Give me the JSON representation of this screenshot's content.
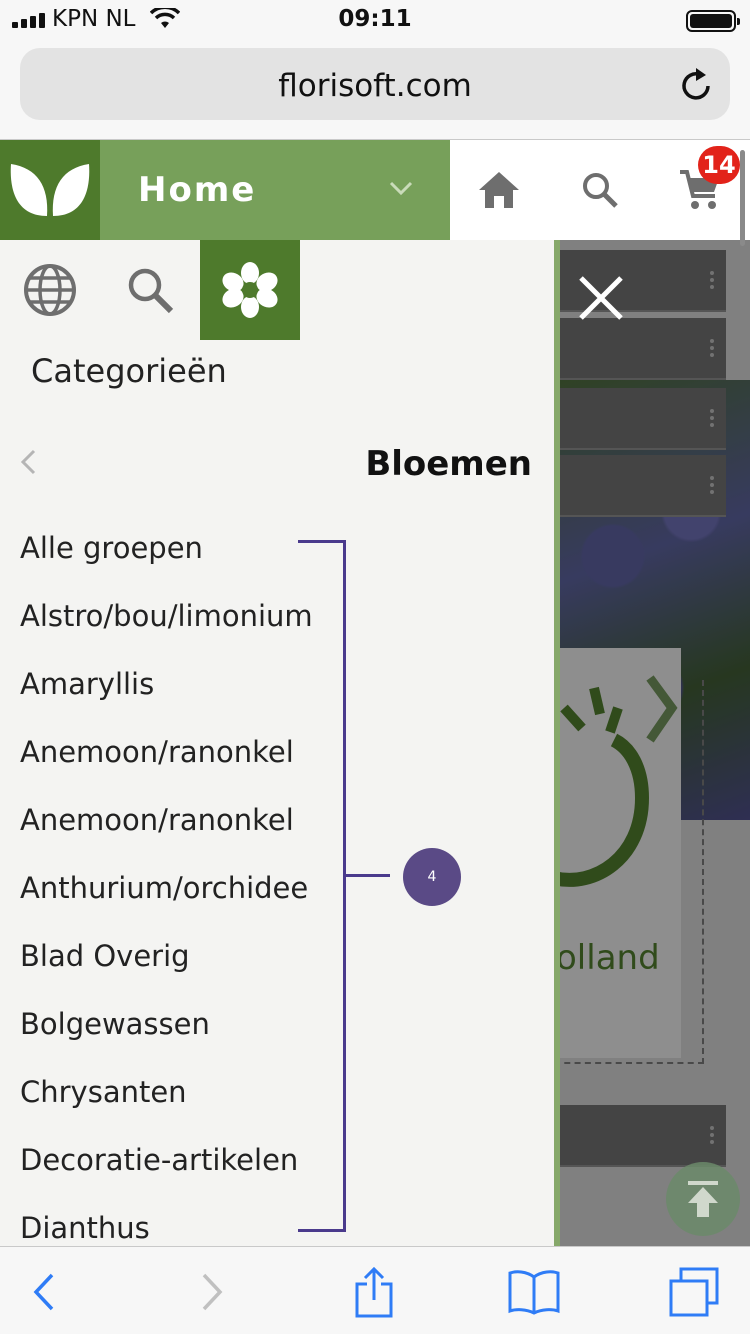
{
  "status_bar": {
    "carrier": "KPN NL",
    "time": "09:11"
  },
  "browser": {
    "url": "florisoft.com"
  },
  "header": {
    "section_label": "Home",
    "cart_count": "14",
    "icons": [
      "home-icon",
      "search-icon",
      "cart-icon"
    ]
  },
  "drawer": {
    "tabs": [
      "globe-icon",
      "search-icon",
      "flower-icon"
    ],
    "active_tab": 2,
    "heading": "Categorieën",
    "level_title": "Bloemen",
    "categories": [
      "Alle groepen",
      "Alstro/bou/limonium",
      "Amaryllis",
      "Anemoon/ranonkel",
      "Anemoon/ranonkel",
      "Anthurium/orchidee",
      "Blad Overig",
      "Bolgewassen",
      "Chrysanten",
      "Decoratie-artikelen",
      "Dianthus"
    ]
  },
  "background_page": {
    "card_text": "olland"
  },
  "annotation": {
    "badge": "4"
  },
  "colors": {
    "brand_dark": "#4e7a2c",
    "brand_light": "#77a05a",
    "badge_red": "#e2231a",
    "annotation": "#4a3a8c"
  }
}
